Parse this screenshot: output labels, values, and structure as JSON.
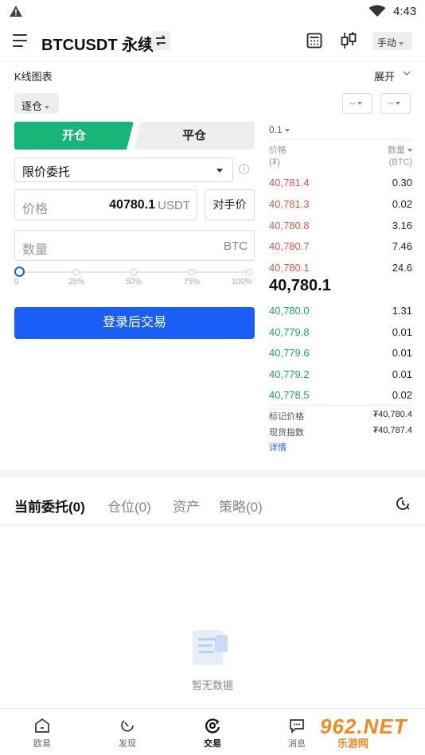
{
  "status_bar": {
    "time": "4:43"
  },
  "header": {
    "pair": "BTCUSDT 永续",
    "mode": "手动"
  },
  "kline": {
    "label": "K线图表",
    "expand": "展开"
  },
  "controls": {
    "margin_mode": "逐仓",
    "leverage_long": "--",
    "leverage_short": "--"
  },
  "tabs": {
    "open": "开仓",
    "close": "平仓"
  },
  "form": {
    "order_type": "限价委托",
    "price_label": "价格",
    "price_value": "40780.1",
    "price_unit": "USDT",
    "bbo_label": "对手价",
    "qty_placeholder": "数量",
    "qty_unit": "BTC",
    "slider_value": 0,
    "slider_ticks": [
      "0",
      "25%",
      "50%",
      "75%",
      "100%"
    ],
    "login_button": "登录后交易"
  },
  "orderbook": {
    "precision": "0.1",
    "price_header": "价格",
    "price_unit": "(₮)",
    "qty_header": "数量",
    "qty_unit": "(BTC)",
    "asks": [
      {
        "price": "40,781.4",
        "qty": "0.30"
      },
      {
        "price": "40,781.3",
        "qty": "0.02"
      },
      {
        "price": "40,780.8",
        "qty": "3.16"
      },
      {
        "price": "40,780.7",
        "qty": "7.46"
      },
      {
        "price": "40,780.1",
        "qty": "24.6"
      }
    ],
    "last_price": "40,780.1",
    "bids": [
      {
        "price": "40,780.0",
        "qty": "1.31"
      },
      {
        "price": "40,779.8",
        "qty": "0.01"
      },
      {
        "price": "40,779.6",
        "qty": "0.01"
      },
      {
        "price": "40,779.2",
        "qty": "0.01"
      },
      {
        "price": "40,778.5",
        "qty": "0.02"
      }
    ],
    "mark_label": "标记价格",
    "mark_value": "₮40,780.4",
    "index_label": "现货指数",
    "index_value": "₮40,787.4",
    "detail_link": "详情"
  },
  "bottom_tabs": {
    "orders": "当前委托(0)",
    "positions": "仓位(0)",
    "assets": "资产",
    "strategy": "策略(0)"
  },
  "empty_state": "暂无数据",
  "nav": {
    "home": "欧易",
    "discover": "发现",
    "trade": "交易",
    "messages": "消息"
  },
  "watermark": {
    "number": "962.NET",
    "site": "乐游网"
  },
  "colors": {
    "green": "#17b678",
    "red": "#e2544c",
    "blue": "#1a5ff5"
  }
}
